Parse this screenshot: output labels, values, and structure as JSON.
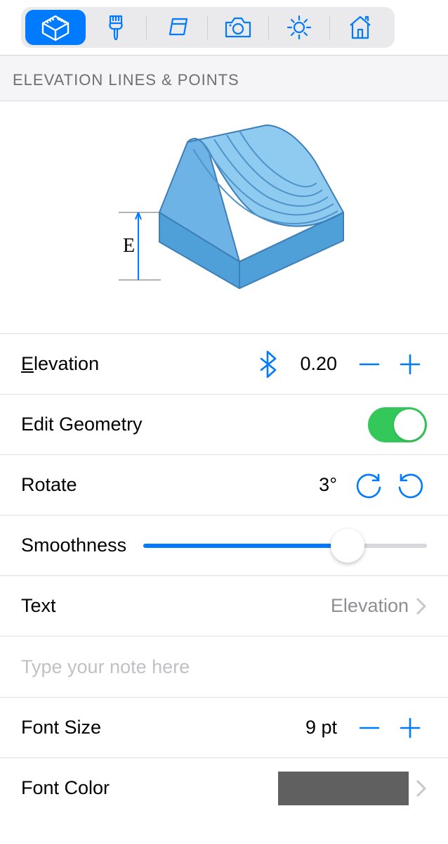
{
  "section_title": "ELEVATION LINES & POINTS",
  "preview_label": "E",
  "rows": {
    "elevation": {
      "label": "Elevation",
      "value": "0.20"
    },
    "edit_geometry": {
      "label": "Edit Geometry",
      "on": true
    },
    "rotate": {
      "label": "Rotate",
      "value": "3°"
    },
    "smoothness": {
      "label": "Smoothness",
      "percent": 72
    },
    "text": {
      "label": "Text",
      "value": "Elevation"
    },
    "note": {
      "placeholder": "Type your note here"
    },
    "font_size": {
      "label": "Font Size",
      "value": "9 pt"
    },
    "font_color": {
      "label": "Font Color",
      "value": "#606060"
    }
  }
}
